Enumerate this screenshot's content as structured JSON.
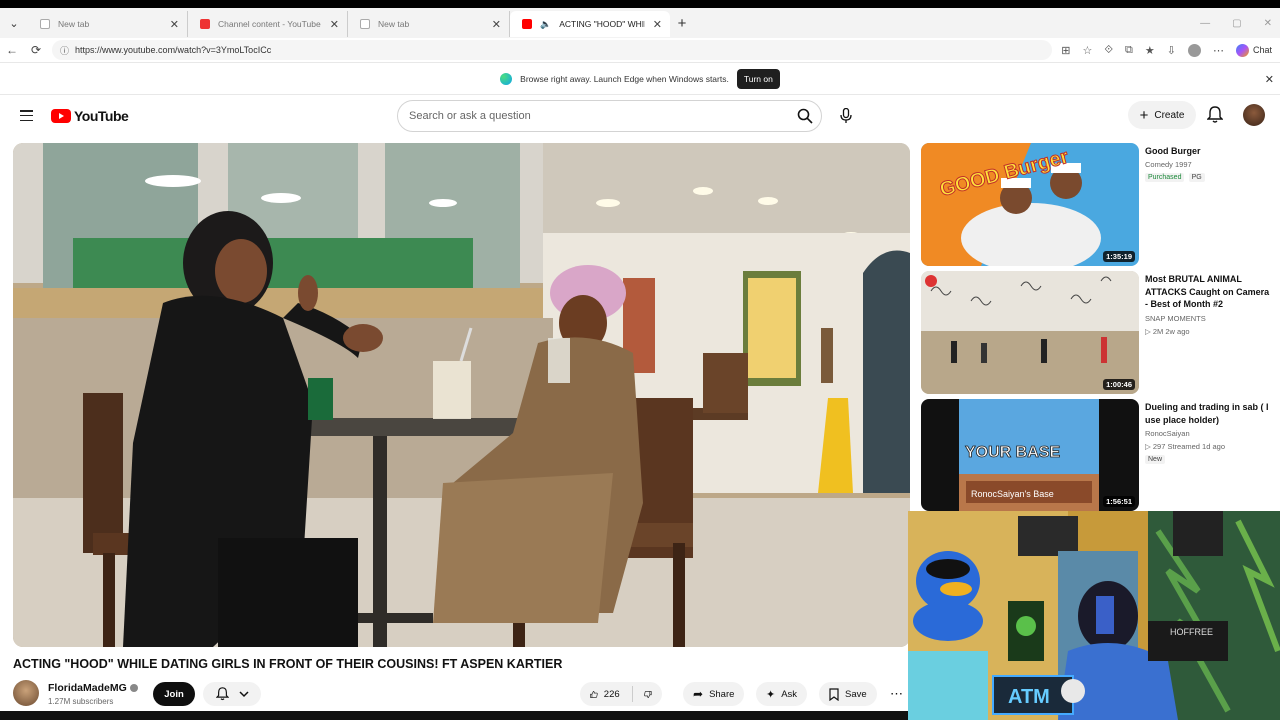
{
  "browser": {
    "tabs": [
      {
        "title": "New tab",
        "active": false,
        "favicon": "newtab-icon"
      },
      {
        "title": "Channel content - YouTube Studio",
        "active": false,
        "favicon": "youtube-studio-icon"
      },
      {
        "title": "New tab",
        "active": false,
        "favicon": "newtab-icon"
      },
      {
        "title": "ACTING \"HOOD\" WHILE DATI",
        "active": true,
        "favicon": "youtube-icon",
        "audio": true
      }
    ],
    "url": "https://www.youtube.com/watch?v=3YmoLTocICc",
    "chat_label": "Chat"
  },
  "infobar": {
    "message": "Browse right away. Launch Edge when Windows starts.",
    "button": "Turn on"
  },
  "youtube": {
    "logo_text": "YouTube",
    "search_placeholder": "Search or ask a question",
    "create_label": "Create"
  },
  "video": {
    "title": "ACTING \"HOOD\" WHILE DATING GIRLS IN FRONT OF THEIR COUSINS! FT ASPEN KARTIER",
    "channel": "FloridaMadeMG",
    "subscribers": "1.27M subscribers",
    "join_label": "Join",
    "likes": "226",
    "share_label": "Share",
    "ask_label": "Ask",
    "save_label": "Save"
  },
  "recommendations": [
    {
      "title": "Good Burger",
      "line1": "Comedy 1997",
      "badges": [
        "Purchased",
        "PG"
      ],
      "duration": "1:35:19",
      "thumb_text": "GOOD Burger"
    },
    {
      "title": "Most BRUTAL ANIMAL ATTACKS Caught on Camera - Best of Month #2",
      "line1": "SNAP MOMENTS",
      "line2": "▷ 2M  2w ago",
      "duration": "1:00:46"
    },
    {
      "title": "Dueling and trading in sab ( I use place holder)",
      "line1": "RonocSaiyan",
      "line2": "▷ 297  Streamed 1d ago",
      "badges": [
        "New"
      ],
      "duration": "1:56:51",
      "thumb_text": "YOUR BASE",
      "thumb_sub": "RonocSaiyan's Base"
    }
  ],
  "webcam": {
    "sign_text": "ATM",
    "shirt_text": "HOFFREE"
  },
  "colors": {
    "youtube_red": "#ff0000",
    "dark_button": "#0f0f0f",
    "pill_gray": "#f2f2f2"
  }
}
